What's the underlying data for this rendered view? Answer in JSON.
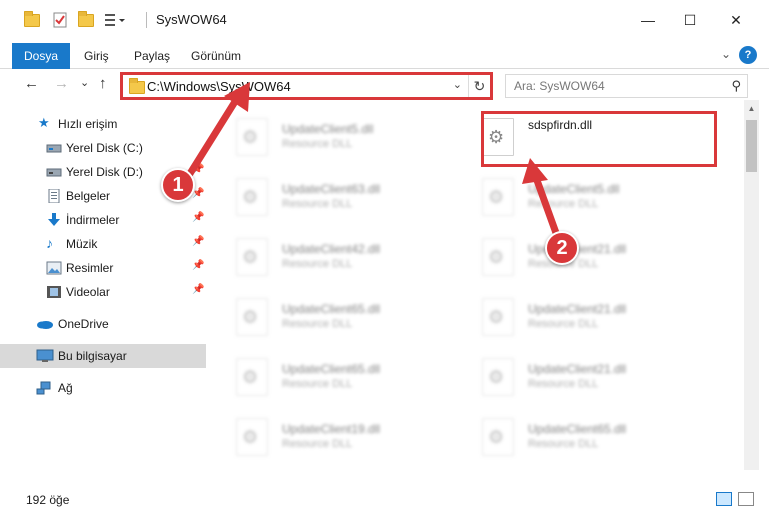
{
  "window": {
    "title": "SysWOW64",
    "minimize_glyph": "—",
    "maximize_glyph": "☐",
    "close_glyph": "✕"
  },
  "ribbon": {
    "file_tab": "Dosya",
    "tabs": [
      "Giriş",
      "Paylaş",
      "Görünüm"
    ],
    "expand_glyph": "⌄",
    "help_glyph": "?"
  },
  "nav": {
    "back_glyph": "←",
    "forward_glyph": "→",
    "recent_glyph": "⌄",
    "up_glyph": "↑"
  },
  "address": {
    "path": "C:\\Windows\\SysWOW64",
    "dropdown_glyph": "⌄",
    "refresh_glyph": "↻"
  },
  "search": {
    "placeholder": "Ara: SysWOW64",
    "icon_glyph": "⚲"
  },
  "sidebar": {
    "quick_access": "Hızlı erişim",
    "items": [
      {
        "label": "Yerel Disk (C:)",
        "icon": "drive-icon",
        "pinned": false
      },
      {
        "label": "Yerel Disk (D:)",
        "icon": "drive-icon",
        "pinned": false
      },
      {
        "label": "Belgeler",
        "icon": "documents-icon",
        "pinned": true
      },
      {
        "label": "İndirmeler",
        "icon": "downloads-icon",
        "pinned": true
      },
      {
        "label": "Müzik",
        "icon": "music-icon",
        "pinned": true
      },
      {
        "label": "Resimler",
        "icon": "pictures-icon",
        "pinned": true
      },
      {
        "label": "Videolar",
        "icon": "videos-icon",
        "pinned": true
      }
    ],
    "pin_glyph": "📌",
    "onedrive": "OneDrive",
    "this_pc": "Bu bilgisayar",
    "network": "Ağ"
  },
  "files": {
    "target": {
      "name": "sdspfirdn.dll"
    },
    "blurred": [
      {
        "name": "UpdateClient5.dll",
        "type": "Resource DLL"
      },
      {
        "name": "UpdateClient63.dll",
        "type": "Resource DLL"
      },
      {
        "name": "UpdateClient5.dll",
        "type": "Resource DLL"
      },
      {
        "name": "UpdateClient42.dll",
        "type": "Resource DLL"
      },
      {
        "name": "UpdateClient21.dll",
        "type": "Resource DLL"
      },
      {
        "name": "UpdateClient65.dll",
        "type": "Resource DLL"
      },
      {
        "name": "UpdateClient21.dll",
        "type": "Resource DLL"
      },
      {
        "name": "UpdateClient65.dll",
        "type": "Resource DLL"
      },
      {
        "name": "UpdateClient21.dll",
        "type": "Resource DLL"
      },
      {
        "name": "UpdateClient19.dll",
        "type": "Resource DLL"
      },
      {
        "name": "UpdateClient65.dll",
        "type": "Resource DLL"
      }
    ]
  },
  "callouts": {
    "one": "1",
    "two": "2"
  },
  "colors": {
    "accent": "#1979ca",
    "annotation_red": "#d9383a",
    "selection": "#d9d9d9"
  },
  "status": {
    "item_count": "192 öğe"
  }
}
